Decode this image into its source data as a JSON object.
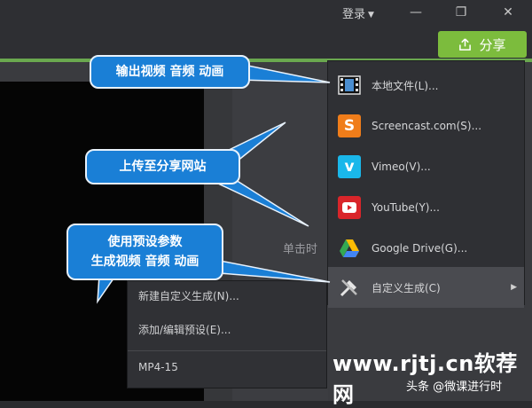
{
  "titlebar": {
    "login_label": "登录",
    "minimize_icon": "—",
    "restore_icon": "❐",
    "close_icon": "✕"
  },
  "share_button": {
    "label": "分享",
    "icon": "upload-icon",
    "color": "#7cbc3d"
  },
  "canvas": {
    "double_click_hint": "单击时"
  },
  "share_menu": {
    "items": [
      {
        "label": "本地文件(L)...",
        "icon": "film-icon"
      },
      {
        "label": "Screencast.com(S)...",
        "icon": "screencast-icon"
      },
      {
        "label": "Vimeo(V)...",
        "icon": "vimeo-icon"
      },
      {
        "label": "YouTube(Y)...",
        "icon": "youtube-icon"
      },
      {
        "label": "Google Drive(G)...",
        "icon": "google-drive-icon"
      },
      {
        "label": "自定义生成(C)",
        "icon": "tools-icon"
      }
    ]
  },
  "submenu": {
    "items": [
      {
        "label": "新建自定义生成(N)..."
      },
      {
        "label": "添加/编辑预设(E)..."
      },
      {
        "label": "MP4-15"
      }
    ]
  },
  "callouts": {
    "local_file": "输出视频 音频 动画",
    "upload": "上传至分享网站",
    "preset_line1": "使用预设参数",
    "preset_line2": "生成视频 音频 动画"
  },
  "watermark": {
    "text": "www.rjtj.cn软荐网",
    "footer": "头条 @微课进行时"
  },
  "colors": {
    "accent_green": "#7cbc3d",
    "callout_blue": "#1a7fd6"
  }
}
